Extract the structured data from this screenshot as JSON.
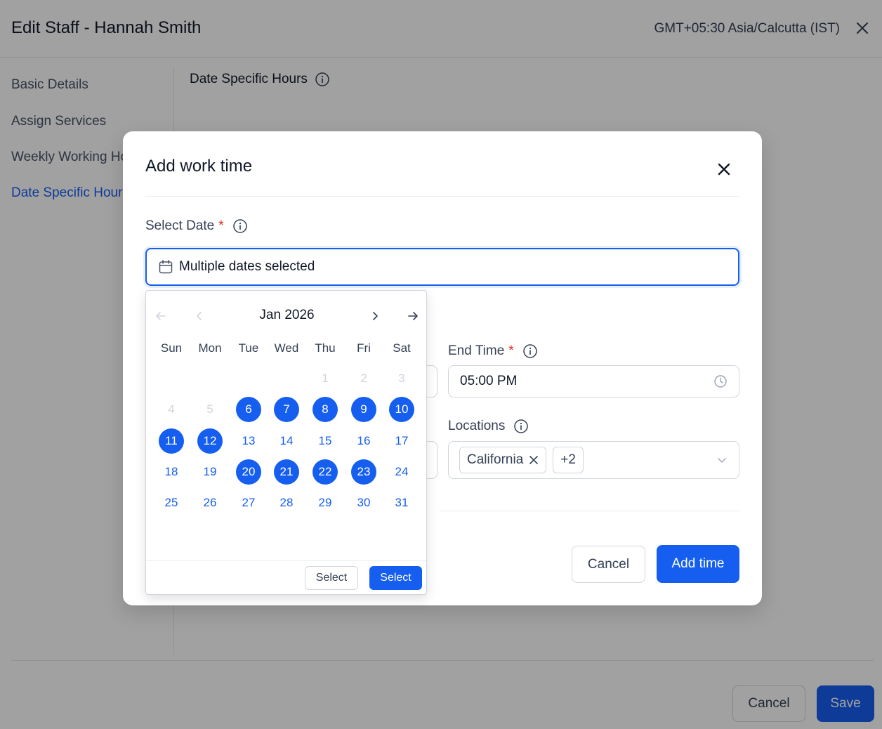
{
  "page": {
    "title": "Edit Staff - Hannah Smith",
    "timezone": "GMT+05:30 Asia/Calcutta (IST)",
    "sidebar": [
      {
        "label": "Basic Details"
      },
      {
        "label": "Assign Services"
      },
      {
        "label": "Weekly Working Hours"
      },
      {
        "label": "Date Specific Hours"
      }
    ],
    "active_section": "Date Specific Hours",
    "section_title": "Date Specific Hours",
    "cancel_label": "Cancel",
    "save_label": "Save"
  },
  "modal": {
    "title": "Add work time",
    "select_date_label": "Select Date",
    "required_mark": "*",
    "date_value": "Multiple dates selected",
    "end_time_label": "End Time",
    "end_time_value": "05:00 PM",
    "locations_label": "Locations",
    "location_tag": "California",
    "location_more": "+2",
    "cancel_label": "Cancel",
    "add_label": "Add time"
  },
  "calendar": {
    "month_label": "Jan 2026",
    "weekdays": [
      "Sun",
      "Mon",
      "Tue",
      "Wed",
      "Thu",
      "Fri",
      "Sat"
    ],
    "weeks": [
      [
        "",
        "",
        "",
        "",
        "1",
        "2",
        "3"
      ],
      [
        "4",
        "5",
        "6",
        "7",
        "8",
        "9",
        "10"
      ],
      [
        "11",
        "12",
        "13",
        "14",
        "15",
        "16",
        "17"
      ],
      [
        "18",
        "19",
        "20",
        "21",
        "22",
        "23",
        "24"
      ],
      [
        "25",
        "26",
        "27",
        "28",
        "29",
        "30",
        "31"
      ]
    ],
    "disabled_days": [
      "1",
      "2",
      "3",
      "4",
      "5"
    ],
    "selected_days": [
      "6",
      "7",
      "8",
      "9",
      "10",
      "11",
      "12",
      "20",
      "21",
      "22",
      "23"
    ],
    "footer_secondary": "Select",
    "footer_primary": "Select"
  },
  "colors": {
    "accent": "#155eef",
    "required": "#d92d20",
    "overlay": "rgba(0,0,0,0.37)"
  }
}
